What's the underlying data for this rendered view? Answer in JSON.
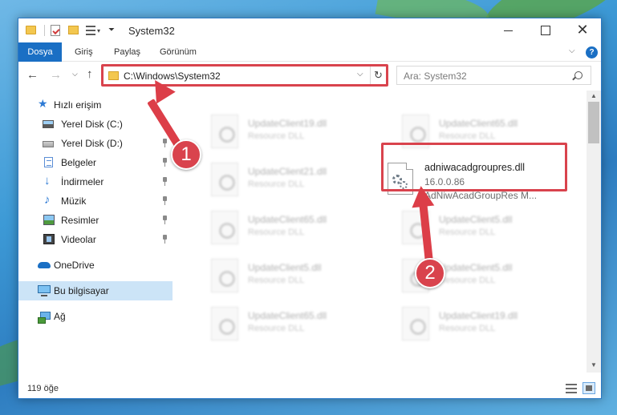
{
  "window": {
    "title": "System32"
  },
  "ribbon": {
    "tabs": [
      "Dosya",
      "Giriş",
      "Paylaş",
      "Görünüm"
    ]
  },
  "address": {
    "path": "C:\\Windows\\System32",
    "search_placeholder": "Ara: System32"
  },
  "sidebar": {
    "quick_access": "Hızlı erişim",
    "items": [
      {
        "label": "Yerel Disk (C:)",
        "icon": "drive-windows-icon",
        "pinned": true
      },
      {
        "label": "Yerel Disk (D:)",
        "icon": "drive-icon",
        "pinned": true
      },
      {
        "label": "Belgeler",
        "icon": "documents-icon",
        "pinned": true
      },
      {
        "label": "İndirmeler",
        "icon": "downloads-icon",
        "pinned": true
      },
      {
        "label": "Müzik",
        "icon": "music-icon",
        "pinned": true
      },
      {
        "label": "Resimler",
        "icon": "pictures-icon",
        "pinned": true
      },
      {
        "label": "Videolar",
        "icon": "videos-icon",
        "pinned": true
      }
    ],
    "onedrive": "OneDrive",
    "this_pc": "Bu bilgisayar",
    "network": "Ağ"
  },
  "files": {
    "blurred": [
      {
        "name": "UpdateClient19.dll",
        "type": "Resource DLL"
      },
      {
        "name": "UpdateClient65.dll",
        "type": "Resource DLL"
      },
      {
        "name": "UpdateClient21.dll",
        "type": "Resource DLL"
      },
      {
        "name": "UpdateClient65.dll",
        "type": "Resource DLL"
      },
      {
        "name": "UpdateClient5.dll",
        "type": "Resource DLL"
      },
      {
        "name": "UpdateClient5.dll",
        "type": "Resource DLL"
      },
      {
        "name": "UpdateClient5.dll",
        "type": "Resource DLL"
      },
      {
        "name": "UpdateClient65.dll",
        "type": "Resource DLL"
      },
      {
        "name": "UpdateClient19.dll",
        "type": "Resource DLL"
      }
    ],
    "highlighted": {
      "name": "adniwacadgroupres.dll",
      "version": "16.0.0.86",
      "description": "AdNiwAcadGroupRes M..."
    }
  },
  "status": {
    "count": "119 öğe"
  },
  "annotations": {
    "step1": "1",
    "step2": "2",
    "color": "#d9434d"
  }
}
